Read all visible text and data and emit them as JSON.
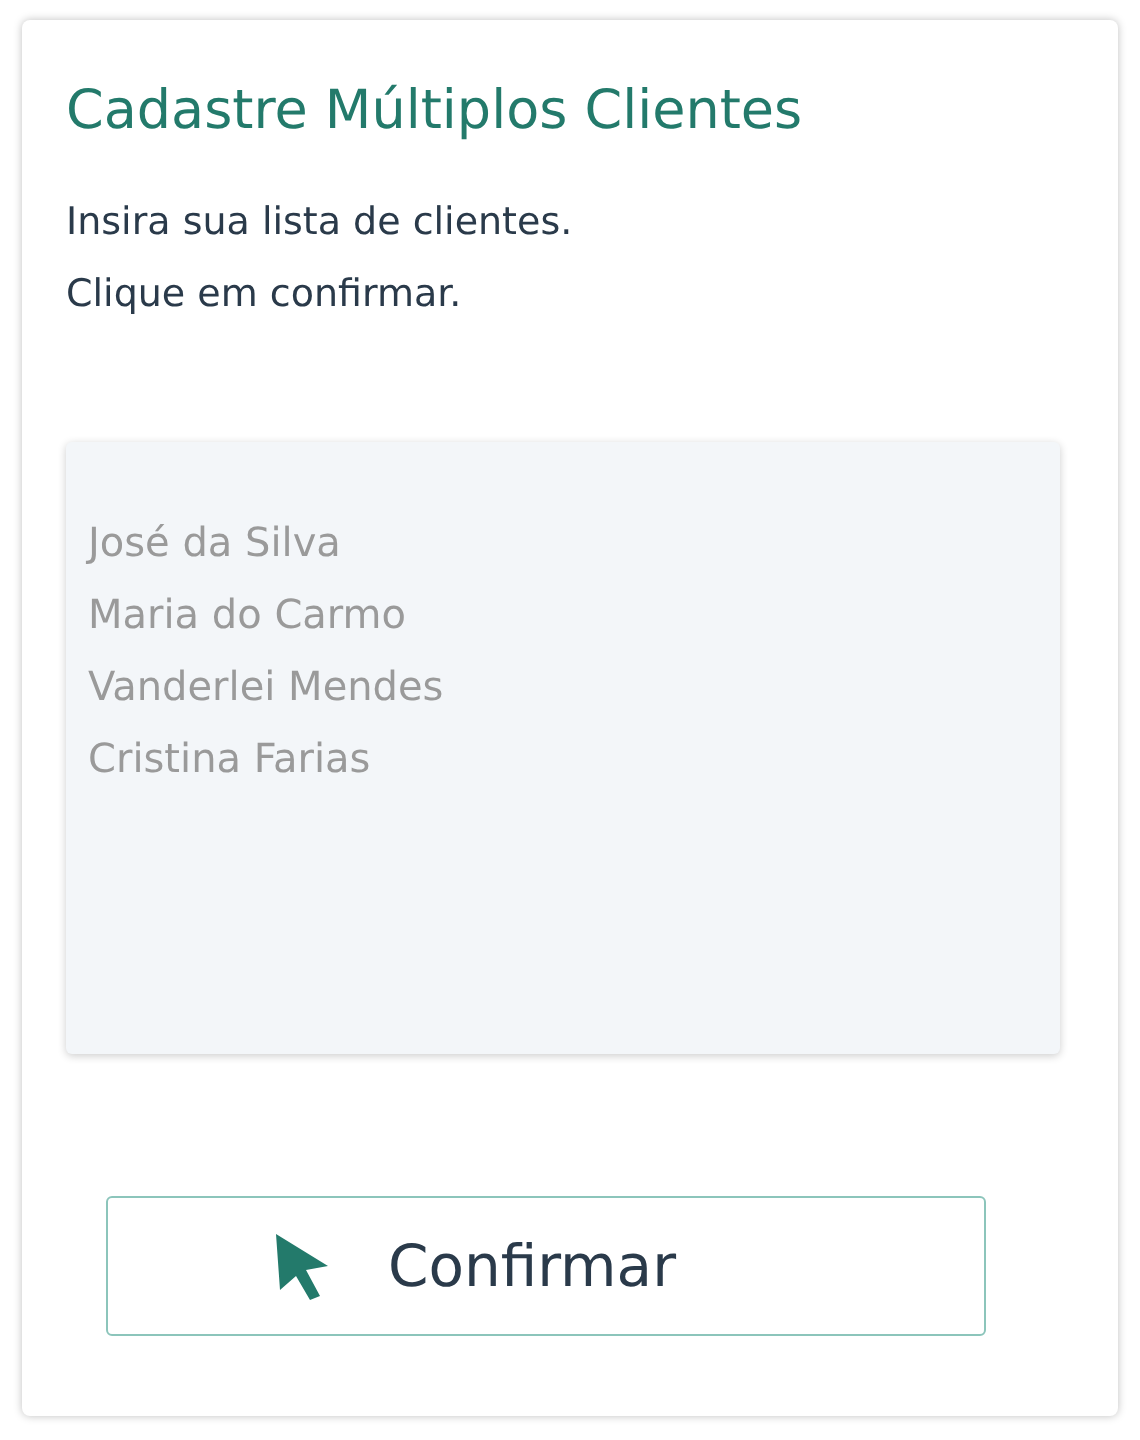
{
  "card": {
    "title": "Cadastre Múltiplos Clientes",
    "instructions": [
      "Insira sua lista de clientes.",
      "Clique em confirmar."
    ],
    "client_list": {
      "placeholder": "José da Silva\nMaria do Carmo\nVanderlei Mendes\nCristina Farias"
    },
    "confirm_button": {
      "label": "Confirmar"
    }
  }
}
